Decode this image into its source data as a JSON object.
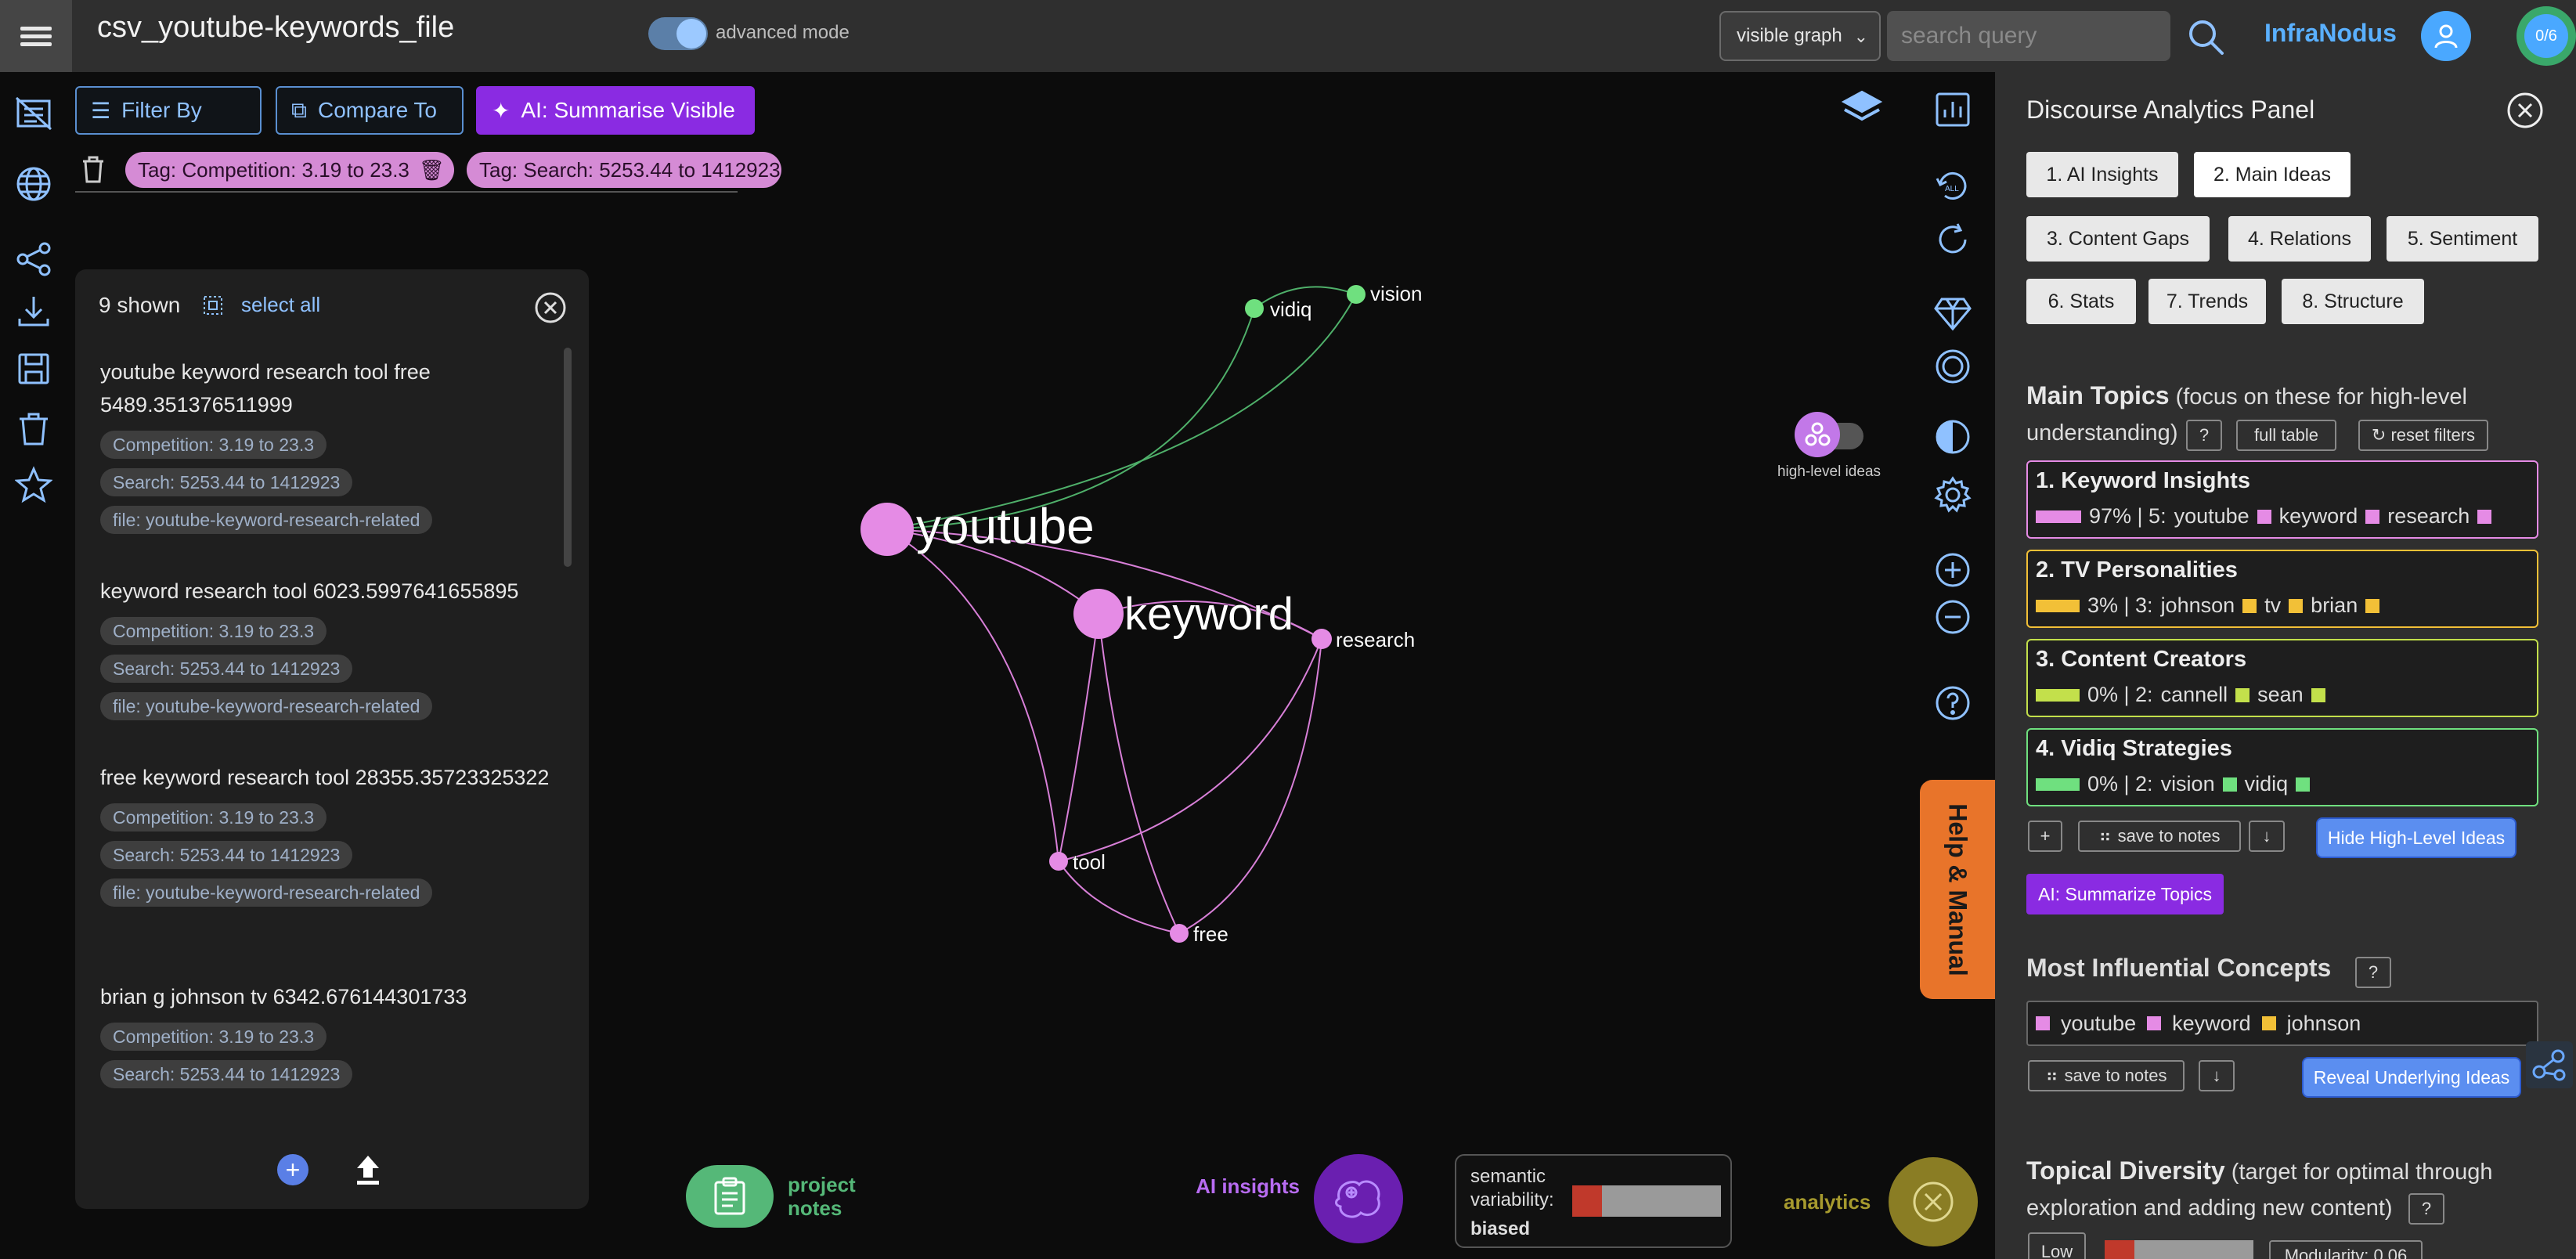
{
  "app": {
    "title": "csv_youtube-keywords_file",
    "advanced_mode_label": "advanced mode",
    "graph_select": "visible graph",
    "search_placeholder": "search query",
    "brand": "InfraNodus",
    "counter": "0/6"
  },
  "toolbar": {
    "filter_by": "Filter By",
    "compare_to": "Compare To",
    "ai_summarise": "AI: Summarise Visible",
    "tags": [
      "Tag: Competition: 3.19 to 23.3",
      "Tag: Search: 5253.44 to 1412923"
    ]
  },
  "docs": {
    "shown": "9 shown",
    "select_all": "select all",
    "items": [
      {
        "text": "youtube keyword research tool free 5489.351376511999",
        "tags": [
          "Competition: 3.19 to 23.3",
          "Search: 5253.44 to 1412923",
          "file: youtube-keyword-research-related"
        ]
      },
      {
        "text": "keyword research tool 6023.5997641655895",
        "tags": [
          "Competition: 3.19 to 23.3",
          "Search: 5253.44 to 1412923",
          "file: youtube-keyword-research-related"
        ]
      },
      {
        "text": "free keyword research tool 28355.35723325322",
        "tags": [
          "Competition: 3.19 to 23.3",
          "Search: 5253.44 to 1412923",
          "file: youtube-keyword-research-related"
        ]
      },
      {
        "text": "brian g johnson tv 6342.676144301733",
        "tags": [
          "Competition: 3.19 to 23.3",
          "Search: 5253.44 to 1412923"
        ]
      }
    ]
  },
  "graph": {
    "nodes": [
      {
        "id": "youtube",
        "label": "youtube",
        "color": "#e58be5",
        "size": "large"
      },
      {
        "id": "keyword",
        "label": "keyword",
        "color": "#e58be5",
        "size": "large"
      },
      {
        "id": "research",
        "label": "research",
        "color": "#e58be5",
        "size": "small"
      },
      {
        "id": "tool",
        "label": "tool",
        "color": "#e58be5",
        "size": "small"
      },
      {
        "id": "free",
        "label": "free",
        "color": "#e58be5",
        "size": "small"
      },
      {
        "id": "vidiq",
        "label": "vidiq",
        "color": "#6fe07f",
        "size": "small"
      },
      {
        "id": "vision",
        "label": "vision",
        "color": "#6fe07f",
        "size": "small"
      }
    ],
    "high_level_ideas_label": "high-level ideas"
  },
  "right_tools": {
    "help_tab": "Help & Manual"
  },
  "bottom": {
    "project_notes": "project notes",
    "ai_insights": "AI insights",
    "semantic_label": "semantic variability:",
    "semantic_value": "biased",
    "semantic_level": 0.2,
    "analytics": "analytics"
  },
  "panel": {
    "title": "Discourse Analytics Panel",
    "tabs": [
      "1. AI Insights",
      "2. Main Ideas",
      "3. Content Gaps",
      "4. Relations",
      "5. Sentiment",
      "6. Stats",
      "7. Trends",
      "8. Structure"
    ],
    "active_tab": "2. Main Ideas",
    "main_topics_heading": "Main Topics",
    "main_topics_note": "(focus on these for high-level understanding)",
    "q_label": "?",
    "full_table": "full table",
    "reset_filters": "↻ reset filters",
    "topics": [
      {
        "title": "1. Keyword Insights",
        "stats": "97% | 5:",
        "words": [
          "youtube",
          "keyword",
          "research"
        ],
        "color": "#e58be5",
        "level": 0.97
      },
      {
        "title": "2. TV Personalities",
        "stats": "3% | 3:",
        "words": [
          "johnson",
          "tv",
          "brian"
        ],
        "color": "#f2c037",
        "level": 0.03
      },
      {
        "title": "3. Content Creators",
        "stats": "0% | 2:",
        "words": [
          "cannell",
          "sean"
        ],
        "color": "#c3e04b",
        "level": 0.0
      },
      {
        "title": "4. Vidiq Strategies",
        "stats": "0% | 2:",
        "words": [
          "vision",
          "vidiq"
        ],
        "color": "#6fe07f",
        "level": 0.0
      }
    ],
    "plus": "+",
    "save_to_notes": "save to notes",
    "download": "↓",
    "hide_high_level": "Hide High-Level Ideas",
    "ai_summarize_topics": "AI: Summarize Topics",
    "influential_heading": "Most Influential Concepts",
    "influential": [
      {
        "word": "youtube",
        "color": "#e58be5"
      },
      {
        "word": "keyword",
        "color": "#e58be5"
      },
      {
        "word": "johnson",
        "color": "#f2c037"
      }
    ],
    "reveal_underlying": "Reveal Underlying Ideas",
    "diversity_heading": "Topical Diversity",
    "diversity_note": "(target for optimal through exploration and adding new content)",
    "low_label": "Low",
    "modularity": "Modularity: 0.06"
  }
}
